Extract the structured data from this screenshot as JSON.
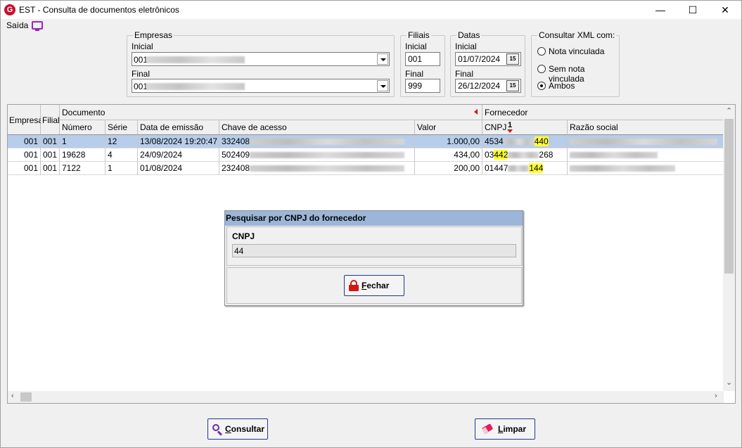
{
  "window": {
    "title": "EST - Consulta de documentos eletrônicos",
    "app_icon_letter": "G",
    "minimize": "—",
    "maximize": "☐",
    "close": "✕"
  },
  "menu": {
    "saida_label": "Saída"
  },
  "empresas": {
    "legend": "Empresas",
    "inicial_label": "Inicial",
    "inicial_value": "001",
    "final_label": "Final",
    "final_value": "001"
  },
  "filiais": {
    "legend": "Filiais",
    "inicial_label": "Inicial",
    "inicial_value": "001",
    "final_label": "Final",
    "final_value": "999"
  },
  "datas": {
    "legend": "Datas",
    "inicial_label": "Inicial",
    "inicial_value": "01/07/2024",
    "final_label": "Final",
    "final_value": "26/12/2024",
    "calendar_glyph": "15"
  },
  "xml": {
    "legend": "Consultar XML com:",
    "options": [
      "Nota vinculada",
      "Sem nota vinculada",
      "Ambos"
    ],
    "selected": "Ambos"
  },
  "grid": {
    "group_headers": {
      "documento": "Documento",
      "fornecedor": "Fornecedor"
    },
    "sort_marker": "1",
    "columns": {
      "empresa": "Empresa",
      "filial": "Filial",
      "numero": "Número",
      "serie": "Série",
      "data": "Data de emissão",
      "chave": "Chave de acesso",
      "valor": "Valor",
      "cnpj": "CNPJ",
      "razao": "Razão social"
    },
    "rows": [
      {
        "empresa": "001",
        "filial": "001",
        "numero": "1",
        "serie": "12",
        "data": "13/08/2024 19:20:47",
        "chave_prefix": "332408",
        "valor": "1.000,00",
        "cnpj_a": "4534",
        "cnpj_hl": "440",
        "cnpj_b": "",
        "selected": true
      },
      {
        "empresa": "001",
        "filial": "001",
        "numero": "19628",
        "serie": "4",
        "data": "24/09/2024",
        "chave_prefix": "502409",
        "valor": "434,00",
        "cnpj_a": "03",
        "cnpj_hl": "442",
        "cnpj_b": "268",
        "selected": false
      },
      {
        "empresa": "001",
        "filial": "001",
        "numero": "7122",
        "serie": "1",
        "data": "01/08/2024",
        "chave_prefix": "232408",
        "valor": "200,00",
        "cnpj_a": "01447",
        "cnpj_hl": "144",
        "cnpj_b": "",
        "selected": false
      }
    ]
  },
  "dialog": {
    "title": "Pesquisar por CNPJ do fornecedor",
    "field_label": "CNPJ",
    "field_value": "44",
    "close_label_u": "F",
    "close_label_rest": "echar"
  },
  "buttons": {
    "consultar_u": "C",
    "consultar_rest": "onsultar",
    "limpar_u": "L",
    "limpar_rest": "impar"
  },
  "colors": {
    "selected_row": "#b7cdea",
    "highlight": "#ffff33",
    "dialog_title": "#9bb6d8",
    "button_border": "#1e3a8a"
  },
  "icons": [
    "app-logo-icon",
    "monitor-icon",
    "calendar-icon",
    "sort-arrow-icon",
    "lock-icon",
    "magnifier-icon",
    "eraser-icon"
  ]
}
